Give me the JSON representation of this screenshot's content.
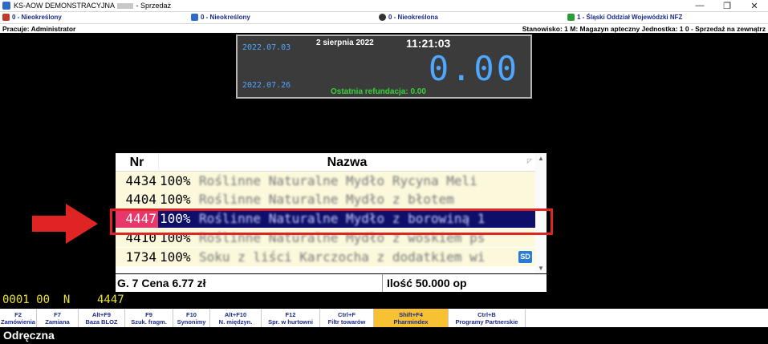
{
  "window": {
    "title_prefix": "KS-AOW DEMONSTRACYJNA",
    "title_suffix": "- Sprzedaż",
    "minimize": "—",
    "maximize": "❐",
    "close": "✕"
  },
  "info_row1": {
    "cell1": "0 - Nieokreślony",
    "cell2": "0 - Nieokreślony",
    "cell3": "0 - Nieokreślona",
    "cell4": "1 - Śląski Oddział Wojewódzki NFZ"
  },
  "info_row2": {
    "user": "Pracuje: Administrator",
    "station": "Stanowisko: 1  M: Magazyn apteczny  Jednostka: 1  0 - Sprzedaż na zewnątrz"
  },
  "status": {
    "date1": "2022.07.03",
    "date2": "2022.07.26",
    "date_text": "2 sierpnia 2022",
    "clock": "11:21:03",
    "amount": "0.00",
    "refund_label": "Ostatnia refundacja: 0.00"
  },
  "list": {
    "header_nr": "Nr",
    "header_name": "Nazwa",
    "rows": [
      {
        "nr": "4434",
        "pct": "100%",
        "name": "Roślinne Naturalne Mydło Rycyna Meli"
      },
      {
        "nr": "4404",
        "pct": "100%",
        "name": "Roślinne Naturalne Mydło z błotem"
      },
      {
        "nr": "4447",
        "pct": "100%",
        "name": "Roślinne Naturalne Mydło z borowiną 1"
      },
      {
        "nr": "4410",
        "pct": "100%",
        "name": "Roślinne Naturalne Mydło z woskiem ps"
      },
      {
        "nr": "1734",
        "pct": "100%",
        "name": "Soku z liści Karczocha z dodatkiem wi",
        "badge": "SD"
      }
    ],
    "selected_index": 2
  },
  "infobar": {
    "left": "G. 7  Cena 6.77 zł",
    "right": "Ilość 50.000 op"
  },
  "bottom_codes": "0001 00  N    4447",
  "fkeys": [
    {
      "key": "F2",
      "label": "Zamówienia",
      "w": 46
    },
    {
      "key": "F7",
      "label": "Zamiana",
      "w": 52
    },
    {
      "key": "Alt+F9",
      "label": "Baza BLOZ",
      "w": 58
    },
    {
      "key": "F9",
      "label": "Szuk. fragm.",
      "w": 60
    },
    {
      "key": "F10",
      "label": "Synonimy",
      "w": 46
    },
    {
      "key": "Alt+F10",
      "label": "N. międzyn.",
      "w": 64
    },
    {
      "key": "F12",
      "label": "Spr. w hurtowni",
      "w": 73
    },
    {
      "key": "Ctrl+F",
      "label": "Filtr towarów",
      "w": 67
    },
    {
      "key": "Shift+F4",
      "label": "Pharmindex",
      "w": 93,
      "active": true
    },
    {
      "key": "Ctrl+B",
      "label": "Programy Partnerskie",
      "w": 96
    }
  ],
  "mode": "Odręczna",
  "colors": {
    "accent_blue": "#4fa7ff",
    "selected_row": "#0d0f6b",
    "selected_nr": "#e8386a",
    "highlight": "#e02323",
    "active_fkey": "#f6c233"
  }
}
